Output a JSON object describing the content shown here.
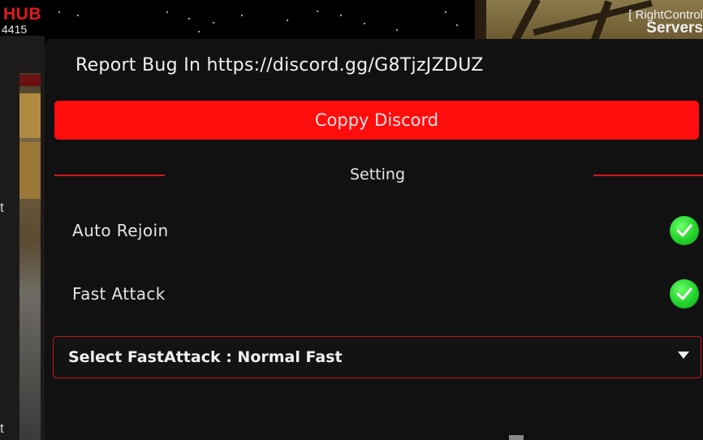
{
  "hud": {
    "hub_logo": "HUB",
    "hub_id": "4415",
    "right_control": "[ RightControl",
    "server_label": "Servers",
    "side_glyphs": [
      "t",
      "t"
    ]
  },
  "panel": {
    "report_text": "Report Bug In https://discord.gg/G8TjzJZDUZ",
    "copy_button_label": "Coppy Discord",
    "section_title": "Setting",
    "toggles": [
      {
        "label": "Auto Rejoin",
        "checked": true
      },
      {
        "label": "Fast Attack",
        "checked": true
      }
    ],
    "dropdown": {
      "label": "Select FastAttack : Normal Fast"
    }
  },
  "colors": {
    "accent_red": "#ff0d0d",
    "separator_red": "#d21818",
    "check_green": "#22d22a",
    "panel_bg": "#111112"
  },
  "icons": {
    "toggle_check": "checkmark-icon",
    "dropdown": "chevron-down-icon"
  }
}
